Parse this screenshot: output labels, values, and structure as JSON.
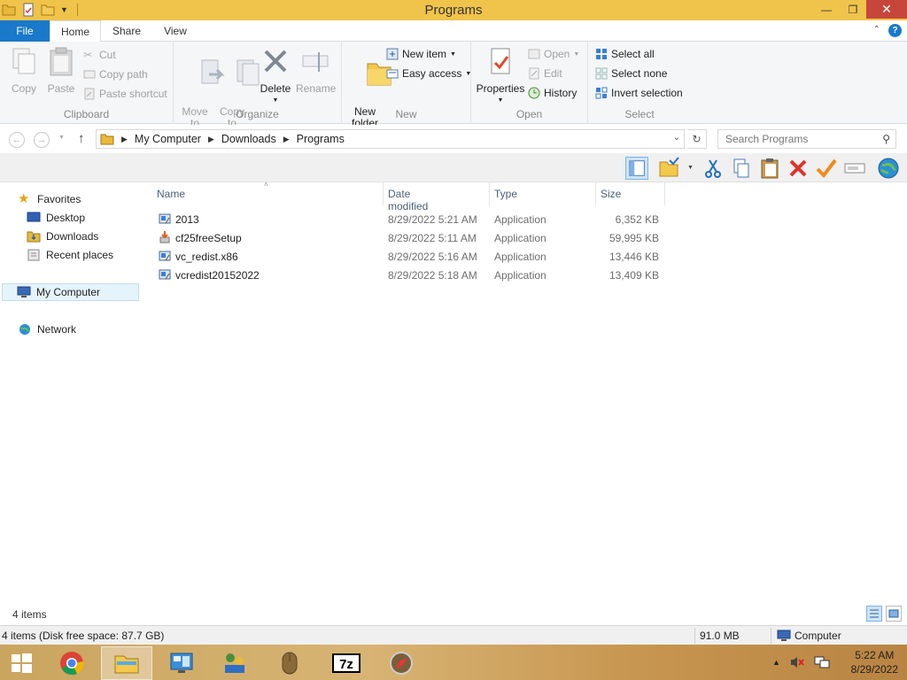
{
  "window": {
    "title": "Programs",
    "buttons": {
      "minimize": "—",
      "maximize": "❐",
      "close": "✕"
    }
  },
  "ribbon_tabs": {
    "file": "File",
    "home": "Home",
    "share": "Share",
    "view": "View",
    "help": "?"
  },
  "clipboard": {
    "copy": "Copy",
    "paste": "Paste",
    "cut": "Cut",
    "copy_path": "Copy path",
    "paste_shortcut": "Paste shortcut",
    "label": "Clipboard"
  },
  "organize": {
    "move_to": "Move\nto",
    "copy_to": "Copy\nto",
    "delete": "Delete",
    "rename": "Rename",
    "label": "Organize"
  },
  "new": {
    "new_folder": "New\nfolder",
    "new_item": "New item",
    "easy_access": "Easy access",
    "label": "New"
  },
  "open": {
    "properties": "Properties",
    "open": "Open",
    "edit": "Edit",
    "history": "History",
    "label": "Open"
  },
  "select": {
    "select_all": "Select all",
    "select_none": "Select none",
    "invert_selection": "Invert selection",
    "label": "Select"
  },
  "address": {
    "crumbs": [
      "My Computer",
      "Downloads",
      "Programs"
    ],
    "search_placeholder": "Search Programs"
  },
  "navpane": {
    "favorites": "Favorites",
    "desktop": "Desktop",
    "downloads": "Downloads",
    "recent_places": "Recent places",
    "my_computer": "My Computer",
    "network": "Network"
  },
  "columns": {
    "name": "Name",
    "date": "Date modified",
    "type": "Type",
    "size": "Size"
  },
  "files": [
    {
      "name": "2013",
      "date": "8/29/2022 5:21 AM",
      "type": "Application",
      "size": "6,352 KB",
      "icon": "installer-icon"
    },
    {
      "name": "cf25freeSetup",
      "date": "8/29/2022 5:11 AM",
      "type": "Application",
      "size": "59,995 KB",
      "icon": "setup-icon"
    },
    {
      "name": "vc_redist.x86",
      "date": "8/29/2022 5:16 AM",
      "type": "Application",
      "size": "13,446 KB",
      "icon": "installer-icon"
    },
    {
      "name": "vcredist20152022",
      "date": "8/29/2022 5:18 AM",
      "type": "Application",
      "size": "13,409 KB",
      "icon": "installer-icon"
    }
  ],
  "status": {
    "item_count": "4 items",
    "detail": "4 items (Disk free space: 87.7 GB)",
    "size": "91.0 MB",
    "location": "Computer"
  },
  "clock": {
    "time": "5:22 AM",
    "date": "8/29/2022"
  },
  "colors": {
    "titlebar": "#f0c34a",
    "file_tab": "#1979ca",
    "close": "#c7463b"
  }
}
